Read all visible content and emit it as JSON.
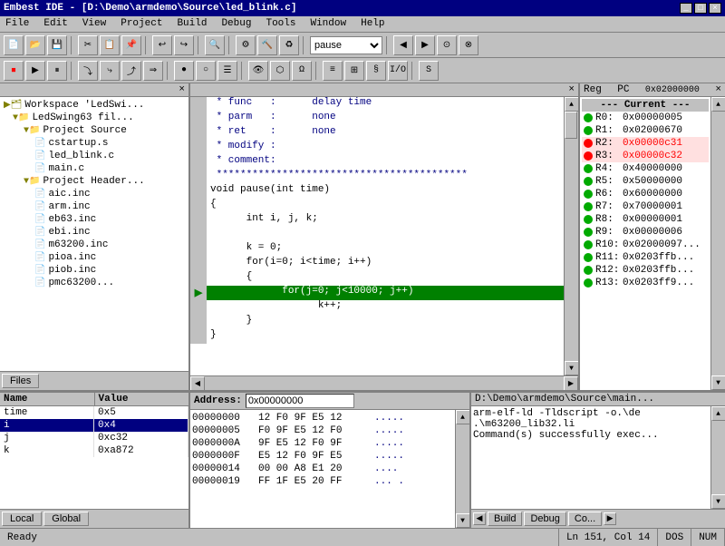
{
  "titleBar": {
    "title": "Embest IDE - [D:\\Demo\\armdemo\\Source\\led_blink.c]",
    "buttons": [
      "_",
      "□",
      "×"
    ]
  },
  "menuBar": {
    "items": [
      "File",
      "Edit",
      "View",
      "Project",
      "Build",
      "Debug",
      "Tools",
      "Window",
      "Help"
    ]
  },
  "toolbar": {
    "combo_placeholder": "pause"
  },
  "filePanel": {
    "title": "",
    "workspace": "Workspace 'LedSwi...",
    "project": "LedSwing63 fil...",
    "projectSource": "Project Source",
    "files": [
      {
        "name": "cstartup.s",
        "type": "file"
      },
      {
        "name": "led_blink.c",
        "type": "file"
      },
      {
        "name": "main.c",
        "type": "file"
      }
    ],
    "projectHeaders": "Project Header...",
    "headers": [
      {
        "name": "aic.inc",
        "type": "file"
      },
      {
        "name": "arm.inc",
        "type": "file"
      },
      {
        "name": "eb63.inc",
        "type": "file"
      },
      {
        "name": "ebi.inc",
        "type": "file"
      },
      {
        "name": "m63200.inc",
        "type": "file"
      },
      {
        "name": "pioa.inc",
        "type": "file"
      },
      {
        "name": "piob.inc",
        "type": "file"
      },
      {
        "name": "pmc63200...",
        "type": "file"
      }
    ],
    "tabs": [
      "Files"
    ]
  },
  "codeEditor": {
    "lines": [
      {
        "arrow": false,
        "text": " * func   :      delay time",
        "class": "code-comment"
      },
      {
        "arrow": false,
        "text": " * parm   :      none",
        "class": "code-comment"
      },
      {
        "arrow": false,
        "text": " * ret    :      none",
        "class": "code-comment"
      },
      {
        "arrow": false,
        "text": " * modify :      ",
        "class": "code-comment"
      },
      {
        "arrow": false,
        "text": " * comment:      ",
        "class": "code-comment"
      },
      {
        "arrow": false,
        "text": " ******************************************",
        "class": "code-comment"
      },
      {
        "arrow": false,
        "text": "void pause(int time)",
        "class": ""
      },
      {
        "arrow": false,
        "text": "{",
        "class": ""
      },
      {
        "arrow": false,
        "text": "      int i, j, k;",
        "class": ""
      },
      {
        "arrow": false,
        "text": "",
        "class": ""
      },
      {
        "arrow": false,
        "text": "      k = 0;",
        "class": ""
      },
      {
        "arrow": false,
        "text": "      for(i=0; i<time; i++)",
        "class": ""
      },
      {
        "arrow": false,
        "text": "      {",
        "class": ""
      },
      {
        "arrow": true,
        "text": "            for(j=0; j<10000; j++)",
        "class": "highlighted"
      },
      {
        "arrow": false,
        "text": "                  k++;",
        "class": ""
      },
      {
        "arrow": false,
        "text": "      }",
        "class": ""
      },
      {
        "arrow": false,
        "text": "}",
        "class": ""
      }
    ]
  },
  "registers": {
    "title": "Reg",
    "pc_label": "PC",
    "pc_value": "0x02000000",
    "section_label": "--- Current ---",
    "regs": [
      {
        "name": "R0:",
        "value": "0x00000005",
        "dot_color": "#00aa00",
        "highlight": ""
      },
      {
        "name": "R1:",
        "value": "0x02000670",
        "dot_color": "#00aa00",
        "highlight": ""
      },
      {
        "name": "R2:",
        "value": "0x00000c31",
        "dot_color": "#ff0000",
        "highlight": "red"
      },
      {
        "name": "R3:",
        "value": "0x00000c32",
        "dot_color": "#ff0000",
        "highlight": "red"
      },
      {
        "name": "R4:",
        "value": "0x40000000",
        "dot_color": "#00aa00",
        "highlight": ""
      },
      {
        "name": "R5:",
        "value": "0x50000000",
        "dot_color": "#00aa00",
        "highlight": ""
      },
      {
        "name": "R6:",
        "value": "0x60000000",
        "dot_color": "#00aa00",
        "highlight": ""
      },
      {
        "name": "R7:",
        "value": "0x70000001",
        "dot_color": "#00aa00",
        "highlight": ""
      },
      {
        "name": "R8:",
        "value": "0x00000001",
        "dot_color": "#00aa00",
        "highlight": ""
      },
      {
        "name": "R9:",
        "value": "0x00000006",
        "dot_color": "#00aa00",
        "highlight": ""
      },
      {
        "name": "R10:",
        "value": "0x02000097...",
        "dot_color": "#00aa00",
        "highlight": ""
      },
      {
        "name": "R11:",
        "value": "0x0203ffb...",
        "dot_color": "#00aa00",
        "highlight": ""
      },
      {
        "name": "R12:",
        "value": "0x0203ffb...",
        "dot_color": "#00aa00",
        "highlight": ""
      },
      {
        "name": "R13:",
        "value": "0x0203ff9...",
        "dot_color": "#00aa00",
        "highlight": ""
      }
    ]
  },
  "variables": {
    "col_name": "Name",
    "col_value": "Value",
    "rows": [
      {
        "name": "time",
        "value": "0x5",
        "selected": false
      },
      {
        "name": "i",
        "value": "0x4",
        "selected": true
      },
      {
        "name": "j",
        "value": "0xc32",
        "selected": false
      },
      {
        "name": "k",
        "value": "0xa872",
        "selected": false
      }
    ],
    "tabs": [
      "Local",
      "Global"
    ]
  },
  "memory": {
    "address_label": "Address:",
    "address_value": "0x00000000",
    "rows": [
      {
        "addr": "00000000",
        "bytes": "12 F0 9F E5 12",
        "chars": "....."
      },
      {
        "addr": "00000005",
        "bytes": "F0 9F E5 12 F0",
        "chars": "....."
      },
      {
        "addr": "0000000A",
        "bytes": "9F E5 12 F0 9F",
        "chars": "....."
      },
      {
        "addr": "0000000F",
        "bytes": "E5 12 F0 9F E5",
        "chars": "....."
      },
      {
        "addr": "00000014",
        "bytes": "00 00 A8 E1 20",
        "chars": "...."
      },
      {
        "addr": "00000019",
        "bytes": "FF 1F E5 20 FF",
        "chars": "... ."
      }
    ]
  },
  "console": {
    "header": "D:\\Demo\\armdemo\\Source\\main...",
    "lines": [
      "arm-elf-ld -Tldscript -o.\\de",
      ".\\m63200_lib32.li",
      "",
      "Command(s) successfully exec..."
    ],
    "tabs": [
      "Build",
      "Debug",
      "Co..."
    ]
  },
  "statusBar": {
    "ready": "Ready",
    "position": "Ln 151, Col 14",
    "dos": "DOS",
    "num": "NUM"
  }
}
